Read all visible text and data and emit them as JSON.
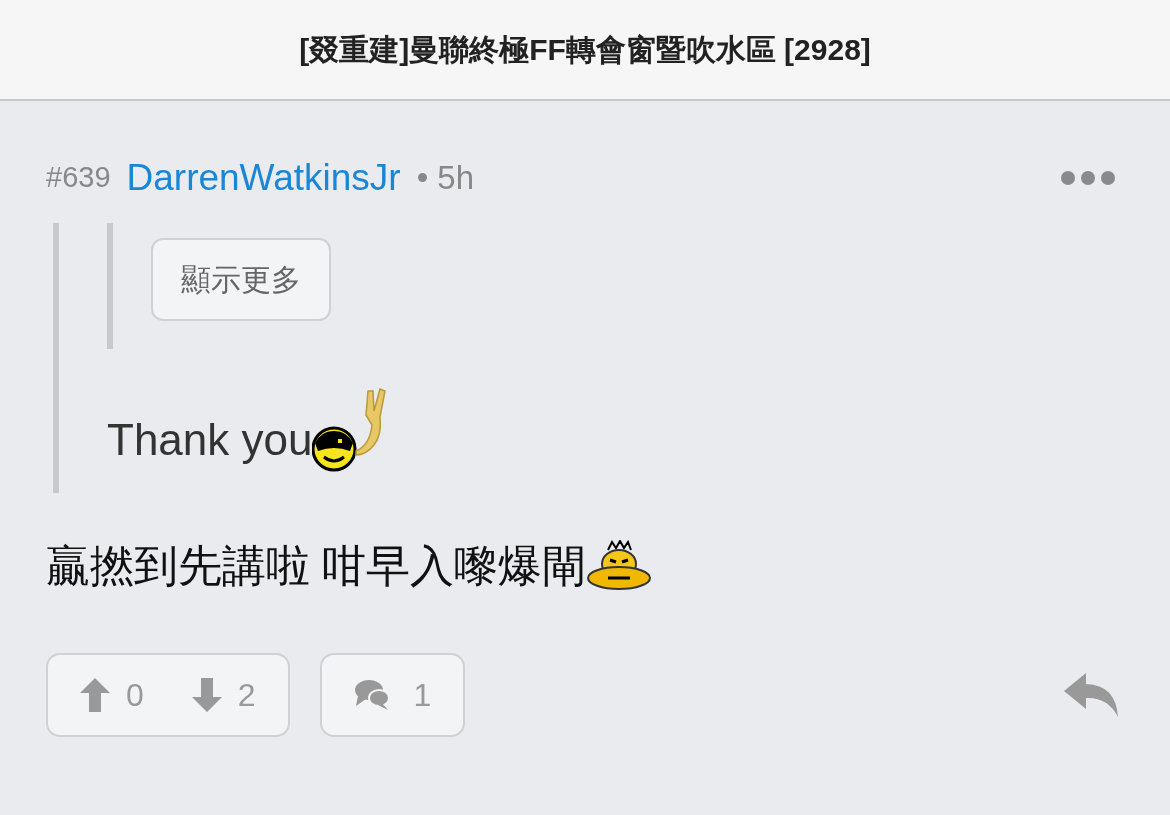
{
  "title": "[叕重建]曼聯終極FF轉會窗暨吹水區 [2928]",
  "post": {
    "number": "#639",
    "author": "DarrenWatkinsJr",
    "time": "• 5h"
  },
  "quote": {
    "nested": {
      "show_more": "顯示更多"
    },
    "text": "Thank you"
  },
  "content": "贏撚到先講啦 咁早入嚟爆閘",
  "actions": {
    "upvotes": "0",
    "downvotes": "2",
    "replies": "1"
  }
}
